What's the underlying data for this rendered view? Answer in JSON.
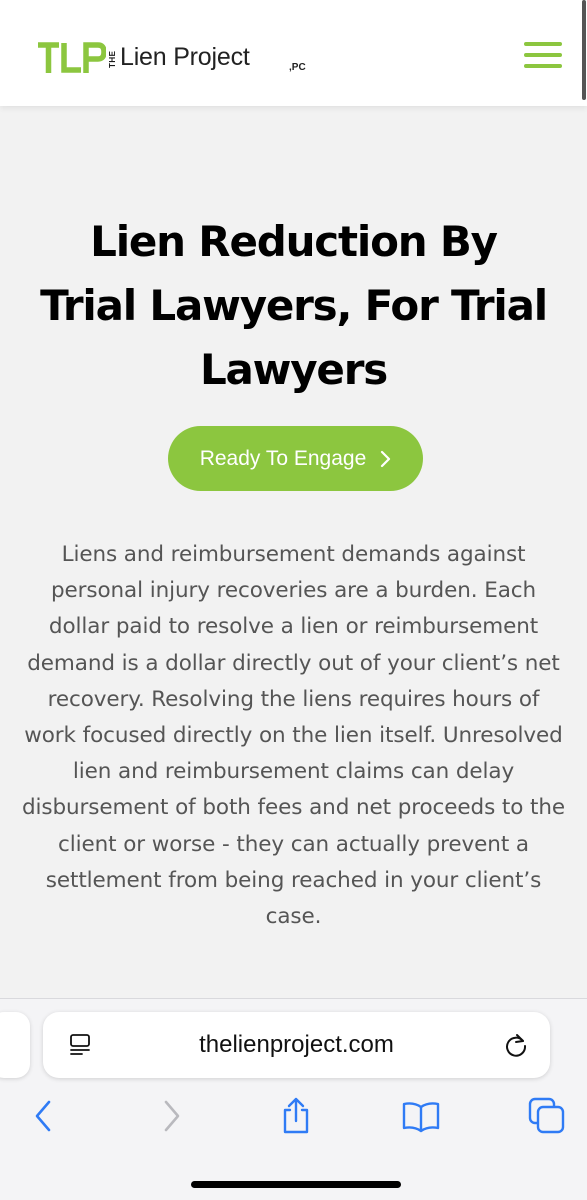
{
  "header": {
    "logo_the": "THE",
    "logo_name": "Lien Project",
    "logo_suffix": ",PC",
    "brand_color": "#8cc63f"
  },
  "hero": {
    "title": "Lien Reduction By Trial Lawyers, For Trial Lawyers",
    "cta_label": "Ready To Engage",
    "cta_icon": "chevron-right-icon"
  },
  "intro_text": "Liens and reimbursement demands against personal injury recoveries are a burden. Each dollar paid to resolve a lien or reimbursement demand is a dollar directly out of your client’s net recovery.  Resolving the liens requires hours of work focused directly on the lien itself.  Unresolved lien and reimbursement claims can delay disbursement of both fees and net proceeds to the client or worse - they can actually prevent a settlement from being reached in your client’s case.",
  "browser": {
    "url": "thelienproject.com",
    "accent_color": "#2f7bf5",
    "toolbar_icons": [
      "back-icon",
      "forward-icon",
      "share-icon",
      "bookmarks-icon",
      "tabs-icon"
    ]
  }
}
